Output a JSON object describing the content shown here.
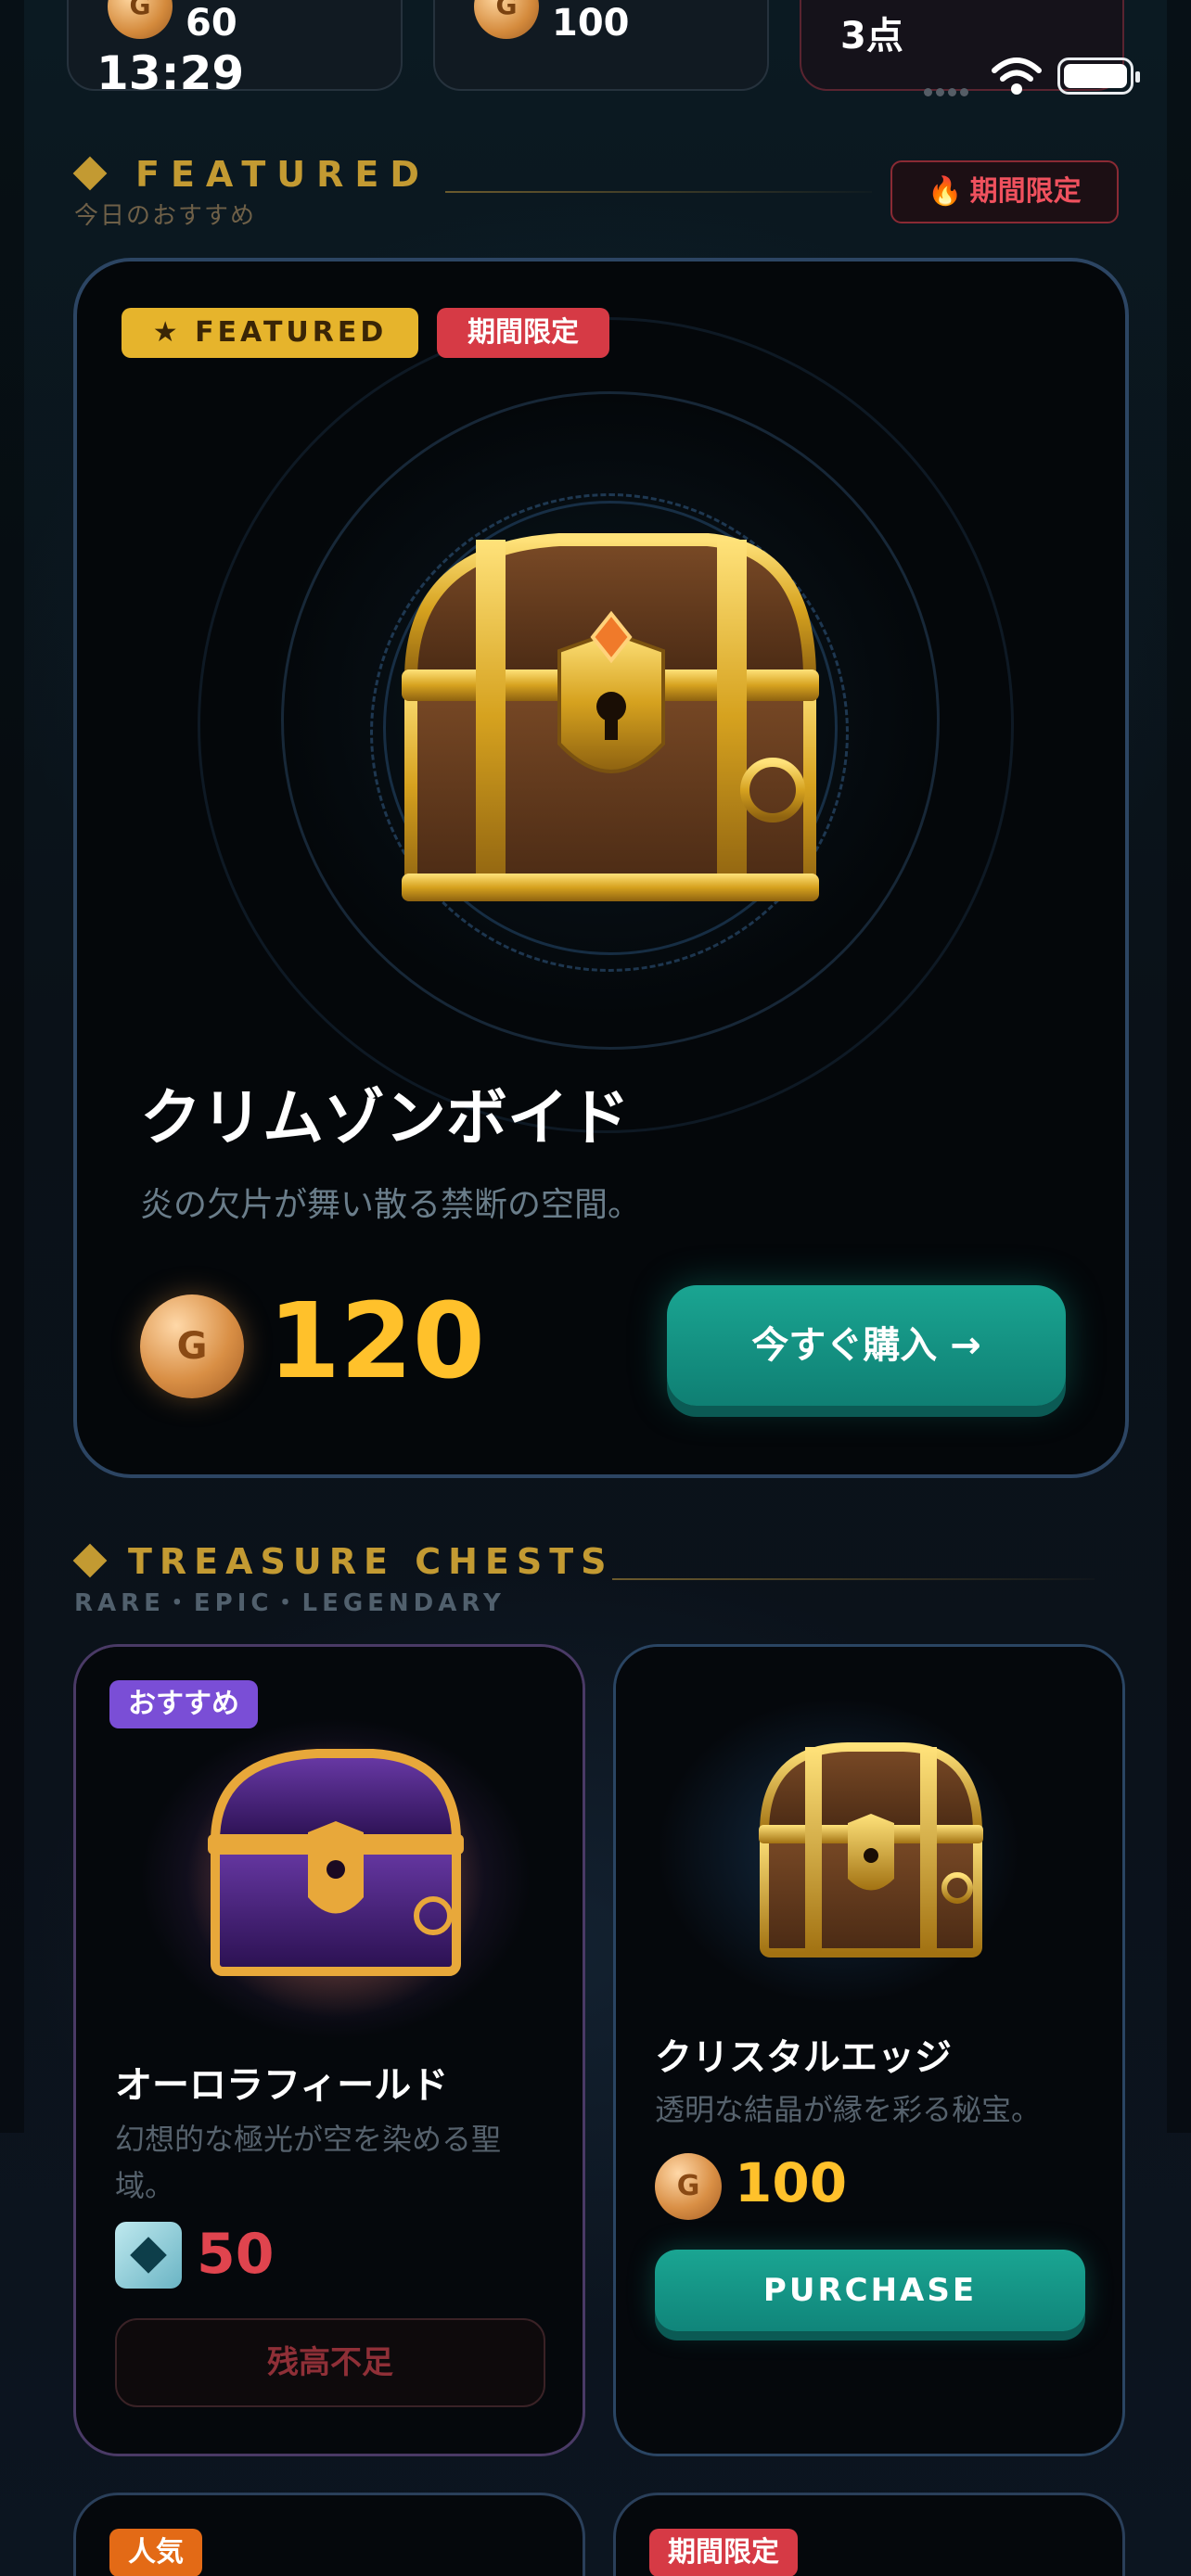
{
  "wallet_strip": [
    {
      "coin_label": "G",
      "value": "60"
    },
    {
      "coin_label": "G",
      "value": "100"
    },
    {
      "value": "3点"
    }
  ],
  "status_bar": {
    "time": "13:29"
  },
  "featured_section": {
    "title": "FEATURED",
    "subtitle": "今日のおすすめ",
    "limited_pill": "期間限定",
    "flame_icon": "flame-icon"
  },
  "featured_card": {
    "badge_featured": "FEATURED",
    "badge_limited": "期間限定",
    "name": "クリムゾンボイド",
    "description": "炎の欠片が舞い散る禁断の空間。",
    "coin_label": "G",
    "price": "120",
    "buy_label": "今すぐ購入 →"
  },
  "chests_section": {
    "title": "TREASURE CHESTS",
    "subtitle": "RARE・EPIC・LEGENDARY"
  },
  "chests": [
    {
      "tag": "おすすめ",
      "name": "オーロラフィールド",
      "description": "幻想的な極光が空を染める聖域。",
      "price": "50",
      "currency": "gem",
      "action_label": "残高不足"
    },
    {
      "tag": "",
      "name": "クリスタルエッジ",
      "description": "透明な結晶が縁を彩る秘宝。",
      "price": "100",
      "currency": "coin",
      "coin_label": "G",
      "action_label": "PURCHASE"
    },
    {
      "tag": "人気"
    },
    {
      "tag": "期間限定"
    }
  ],
  "colors": {
    "gold": "#ffc12b",
    "accent_teal": "#1aa592",
    "danger_red": "#d63a45",
    "section_gold": "#c39a32"
  }
}
